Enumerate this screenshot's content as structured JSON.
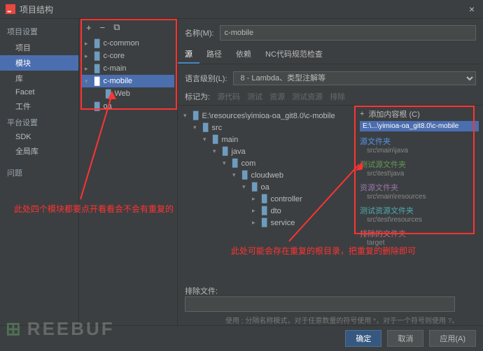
{
  "window": {
    "title": "项目结构"
  },
  "sidebar": {
    "group1": "项目设置",
    "items1": [
      "项目",
      "模块",
      "库",
      "Facet",
      "工件"
    ],
    "group2": "平台设置",
    "items2": [
      "SDK",
      "全局库"
    ],
    "problem": "问题"
  },
  "module_tree": {
    "toolbar": {
      "add": "+",
      "remove": "−",
      "copy": "⧉"
    },
    "items": [
      {
        "label": "c-common",
        "expandable": true
      },
      {
        "label": "c-core",
        "expandable": true
      },
      {
        "label": "c-main",
        "expandable": true
      },
      {
        "label": "c-mobile",
        "expandable": true,
        "selected": true,
        "expanded": true
      },
      {
        "label": "Web",
        "indent": 1
      },
      {
        "label": "oa",
        "expandable": false
      }
    ]
  },
  "form": {
    "name_label": "名称(M):",
    "name_value": "c-mobile",
    "lang_label": "语言级别(L):",
    "lang_value": "8 - Lambda、类型注解等"
  },
  "tabs": [
    "源",
    "路径",
    "依赖",
    "NC代码规范检查"
  ],
  "markbar": {
    "label": "标记为:",
    "b1": "源代码",
    "b2": "测试",
    "b3": "资源",
    "b4": "测试资源",
    "b5": "排除"
  },
  "src_tree": [
    {
      "d": 0,
      "arrow": "▾",
      "label": "E:\\resources\\yimioa-oa_git8.0\\c-mobile"
    },
    {
      "d": 1,
      "arrow": "▾",
      "label": "src"
    },
    {
      "d": 2,
      "arrow": "▾",
      "label": "main"
    },
    {
      "d": 3,
      "arrow": "▾",
      "label": "java"
    },
    {
      "d": 4,
      "arrow": "▾",
      "label": "com"
    },
    {
      "d": 5,
      "arrow": "▾",
      "label": "cloudweb"
    },
    {
      "d": 6,
      "arrow": "▾",
      "label": "oa"
    },
    {
      "d": 7,
      "arrow": "▸",
      "label": "controller"
    },
    {
      "d": 7,
      "arrow": "▸",
      "label": "dto"
    },
    {
      "d": 7,
      "arrow": "▸",
      "label": "service"
    }
  ],
  "side_panel": {
    "add_root": "添加内容根 (C)",
    "root_path": "E:\\...\\yimioa-oa_git8.0\\c-mobile",
    "sections": [
      {
        "title": "源文件夹",
        "cls": "c-blue",
        "val": "src\\main\\java"
      },
      {
        "title": "测试源文件夹",
        "cls": "c-green",
        "val": "src\\test\\java"
      },
      {
        "title": "资源文件夹",
        "cls": "c-purple",
        "val": "src\\main\\resources"
      },
      {
        "title": "测试资源文件夹",
        "cls": "c-teal",
        "val": "src\\test\\resources"
      },
      {
        "title": "排除的文件夹",
        "cls": "c-red",
        "val": "target"
      }
    ]
  },
  "exclude": {
    "label": "排除文件:",
    "hint": "使用 ; 分隔名称模式，对于任意数量的符号使用 *，对于一个符号则使用 ?。"
  },
  "footer": {
    "ok": "确定",
    "cancel": "取消",
    "apply": "应用(A)"
  },
  "annotations": {
    "left": "此处四个模块都要点开看看会不会有重复的",
    "right": "此处可能会存在重复的根目录，把重复的删除即可"
  }
}
